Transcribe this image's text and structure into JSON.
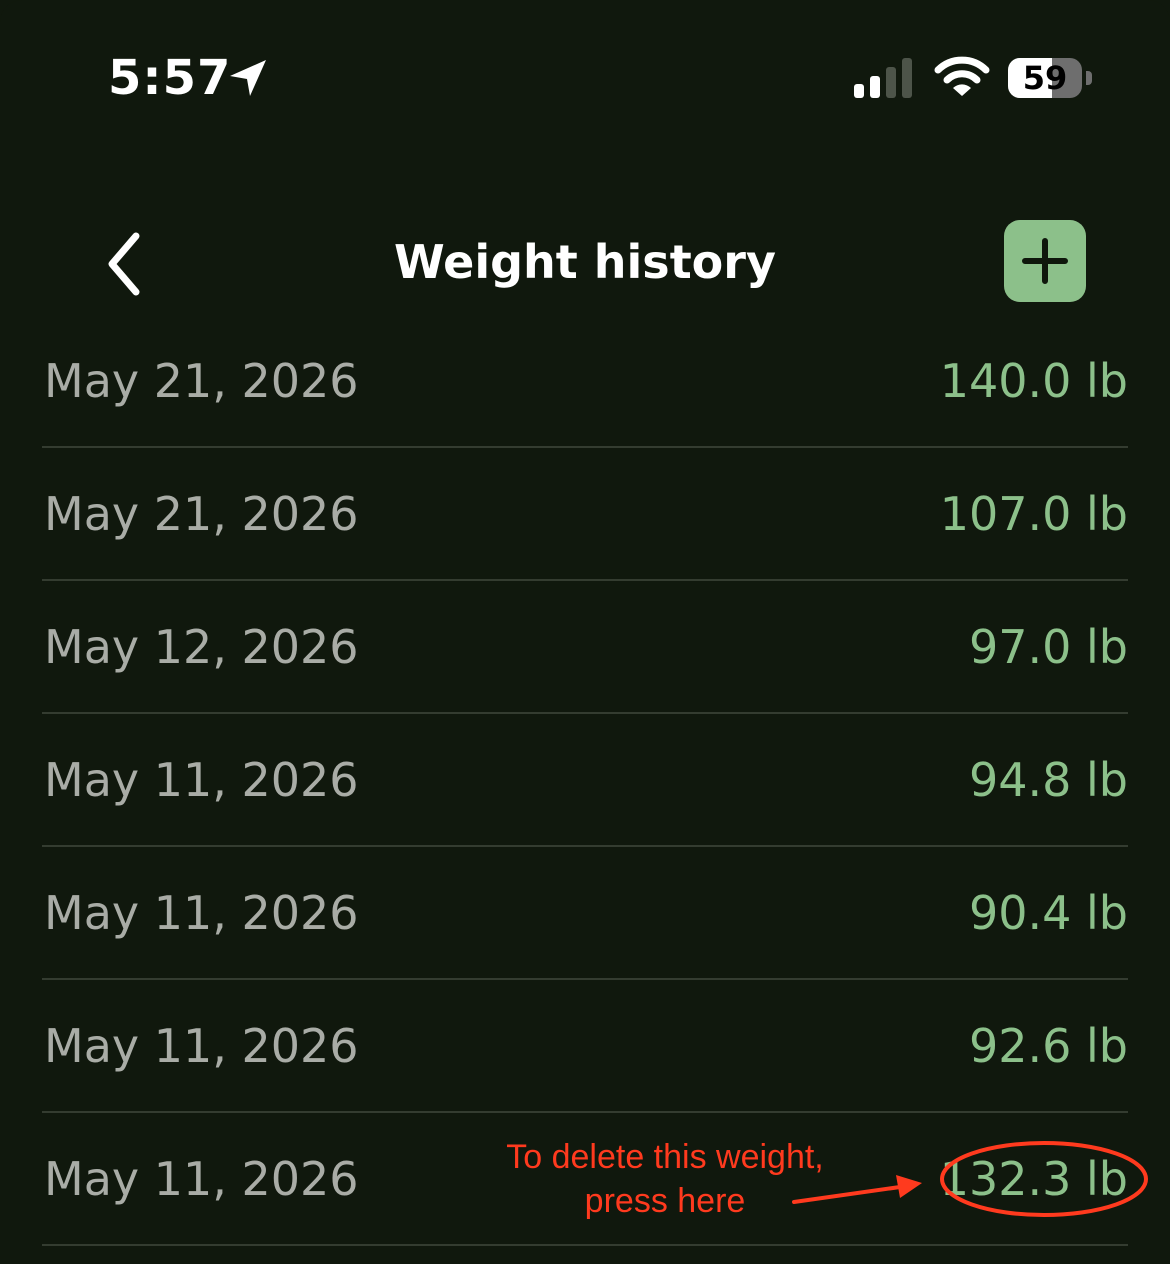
{
  "status_bar": {
    "time": "5:57",
    "battery_level": "59",
    "battery_fraction": 0.59
  },
  "nav": {
    "title": "Weight history",
    "back_icon": "chevron-left-icon",
    "add_icon": "plus-icon"
  },
  "colors": {
    "background": "#10180d",
    "accent": "#8cc08a",
    "date_text": "#a9aca6",
    "annotation": "#ff3a1e"
  },
  "entries": [
    {
      "date": "May 21, 2026",
      "weight": "140.0 lb"
    },
    {
      "date": "May 21, 2026",
      "weight": "107.0 lb"
    },
    {
      "date": "May 12, 2026",
      "weight": "97.0 lb"
    },
    {
      "date": "May 11, 2026",
      "weight": "94.8 lb"
    },
    {
      "date": "May 11, 2026",
      "weight": "90.4 lb"
    },
    {
      "date": "May 11, 2026",
      "weight": "92.6 lb"
    },
    {
      "date": "May 11, 2026",
      "weight": "132.3 lb"
    }
  ],
  "annotation": {
    "line1": "To delete this weight,",
    "line2": "press here"
  }
}
